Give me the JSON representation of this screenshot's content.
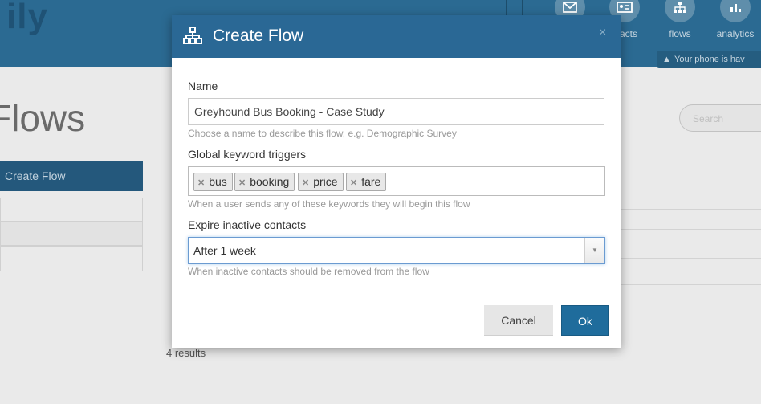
{
  "app": {
    "brand": "ily"
  },
  "nav": [
    {
      "label": "",
      "icon": "phone-icon"
    },
    {
      "label": "",
      "icon": "envelope-icon"
    },
    {
      "label": "ntacts",
      "icon": "address-card-icon"
    },
    {
      "label": "flows",
      "icon": "flow-icon"
    },
    {
      "label": "analytics",
      "icon": "chart-icon"
    }
  ],
  "notice": {
    "text": "Your phone is hav"
  },
  "page": {
    "title": "Flows",
    "search_placeholder": "Search",
    "sidebar_create": "Create Flow",
    "results": "4 results"
  },
  "modal": {
    "title": "Create Flow",
    "close": "×",
    "name": {
      "label": "Name",
      "value": "Greyhound Bus Booking - Case Study",
      "hint": "Choose a name to describe this flow, e.g. Demographic Survey"
    },
    "keywords": {
      "label": "Global keyword triggers",
      "tags": [
        "bus",
        "booking",
        "price",
        "fare"
      ],
      "hint": "When a user sends any of these keywords they will begin this flow"
    },
    "expire": {
      "label": "Expire inactive contacts",
      "selected": "After 1 week",
      "hint": "When inactive contacts should be removed from the flow"
    },
    "buttons": {
      "cancel": "Cancel",
      "ok": "Ok"
    }
  },
  "colors": {
    "header": "#2a6895",
    "topbar": "#2b6a92",
    "ok_button": "#1f6c9c"
  }
}
